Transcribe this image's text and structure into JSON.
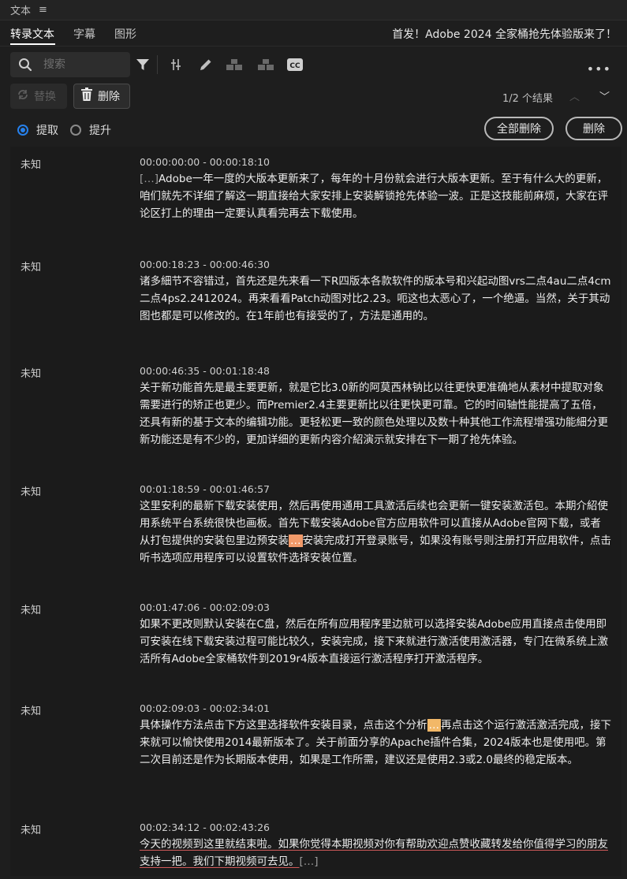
{
  "panel": {
    "title": "文本",
    "menu_glyph": "≡"
  },
  "tabs": [
    {
      "label": "转录文本",
      "active": true
    },
    {
      "label": "字幕",
      "active": false
    },
    {
      "label": "图形",
      "active": false
    }
  ],
  "sequence_title": "首发！Adobe 2024 全家桶抢先体验版来了！",
  "search": {
    "placeholder": "搜索",
    "value": ""
  },
  "toolbar": {
    "icons": [
      "filter-icon",
      "split-icon",
      "pencil-icon",
      "merge-up-icon",
      "merge-down-icon",
      "captions-icon"
    ],
    "more_glyph": "•••"
  },
  "actions": {
    "replace_label": "替换",
    "delete_label": "删除"
  },
  "results": {
    "text": "1/2 个结果",
    "prev_glyph": "︿",
    "next_glyph": "﹀"
  },
  "mode": {
    "extract_label": "提取",
    "lift_label": "提升",
    "selected": "extract"
  },
  "buttons": {
    "delete_all_label": "全部删除",
    "delete_label": "删除"
  },
  "colors": {
    "accent": "#2680eb",
    "highlight_primary": "#f19a6a",
    "highlight_secondary": "#f2b868"
  },
  "segments": [
    {
      "speaker": "未知",
      "timecode": "00:00:00:00 - 00:00:18:10",
      "text_pre": "[…]",
      "text": "Adobe一年一度的大版本更新来了，每年的十月份就会进行大版本更新。至于有什么大的更新，咱们就先不详细了解这一期直接给大家安排上安装解锁抢先体验一波。正是这技能前麻烦，大家在评论区打上的理由一定要认真看完再去下载使用。"
    },
    {
      "speaker": "未知",
      "timecode": "00:00:18:23 - 00:00:46:30",
      "text": "诸多細节不容错过，首先还是先来看一下R四版本各款软件的版本号和兴起动图vrs二点4au二点4cm二点4ps2.2412024。再来看看Patch动图对比2.23。呃这也太恶心了，一个绝逼。当然，关于其动图也都是可以修改的。在1年前也有接受的了，方法是通用的。"
    },
    {
      "speaker": "未知",
      "timecode": "00:00:46:35 - 00:01:18:48",
      "text": "关于新功能首先是最主要更新，就是它比3.0新的阿莫西林钠比以往更快更准确地从素材中提取对象需要进行的矫正也更少。而Premier2.4主要更新比以往更快更可靠。它的时间轴性能提高了五倍，还具有新的基于文本的编辑功能。更轻松更一致的颜色处理以及数十种其他工作流程增强功能細分更新功能还是有不少的，更加详细的更新内容介紹演示就安排在下一期了抢先体验。"
    },
    {
      "speaker": "未知",
      "timecode": "00:01:18:59 - 00:01:46:57",
      "text_before": "这里安利的最新下载安装使用，然后再使用通用工具激活后续也会更新一键安装激活包。本期介紹使用系统平台系统很快也画板。首先下载安装Adobe官方应用软件可以直接从Adobe官网下载，或者从打包提供的安装包里边预安装",
      "highlight": "…",
      "text_after": "安装完成打开登录账号，如果没有账号则注册打开应用软件，点击听书选项应用程序可以设置软件选择安装位置。"
    },
    {
      "speaker": "未知",
      "timecode": "00:01:47:06 - 00:02:09:03",
      "text": "如果不更改则默认安装在C盘，然后在所有应用程序里边就可以选择安装Adobe应用直接点击使用即可安装在线下载安装过程可能比较久，安装完成，接下来就进行激活使用激活器，专门在微系统上激活所有Adobe全家桶软件到2019r4版本直接运行激活程序打开激活程序。"
    },
    {
      "speaker": "未知",
      "timecode": "00:02:09:03 - 00:02:34:01",
      "text_before": "具体操作方法点击下方这里选择软件安装目录，点击这个分析",
      "highlight": "…",
      "text_after": "再点击这个运行激活激活完成，接下来就可以愉快使用2014最新版本了。关于前面分享的Apache插件合集，2024版本也是使用吧。第二次目前还是作为长期版本使用，如果是工作所需，建议还是使用2.3或2.0最终的稳定版本。"
    },
    {
      "speaker": "未知",
      "timecode": "00:02:34:12 - 00:02:43:26",
      "text": "今天的视频到这里就结束啦。如果你觉得本期视频对你有帮助欢迎点赞收藏转发给你值得学习的朋友支持一把。我们下期视频可去见。",
      "text_post": "[…]"
    }
  ]
}
